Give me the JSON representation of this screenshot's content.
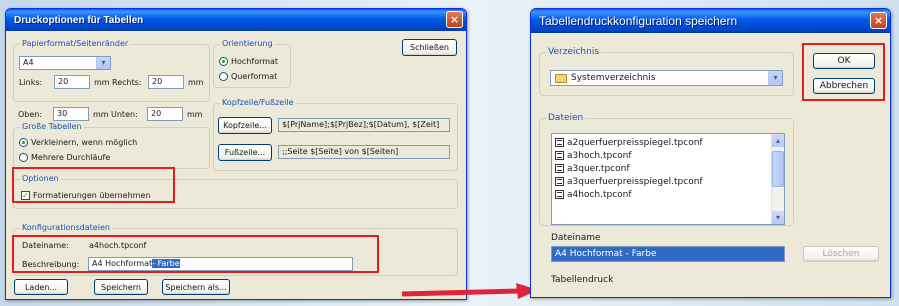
{
  "dialog1": {
    "title": "Druckoptionen für Tabellen",
    "close_glyph": "×",
    "paper_group": "Papierformat/Seitenränder",
    "paper_value": "A4",
    "left_label": "Links:",
    "left_value": "20",
    "left_unit": "mm",
    "right_label": "Rechts:",
    "right_value": "20",
    "right_unit": "mm",
    "top_label": "Oben:",
    "top_value": "30",
    "top_unit": "mm",
    "bottom_label": "Unten:",
    "bottom_value": "20",
    "bottom_unit": "mm",
    "orientation_group": "Orientierung",
    "portrait": "Hochformat",
    "landscape": "Querformat",
    "close_button": "Schließen",
    "large_tables_group": "Große Tabellen",
    "shrink_option": "Verkleinern, wenn möglich",
    "multi_option": "Mehrere Durchläufe",
    "header_footer_group": "Kopfzeile/Fußzeile",
    "header_button": "Kopfzeile...",
    "header_value": "$[PrjName];$[PrjBez];$[Datum], $[Zeit]",
    "footer_button": "Fußzeile...",
    "footer_value": ";;Seite $[Seite] von $[Seiten]",
    "options_group": "Optionen",
    "apply_formatting": "Formatierungen übernehmen",
    "config_group": "Konfigurationsdateien",
    "filename_label": "Dateiname:",
    "filename_value": "a4hoch.tpconf",
    "description_label": "Beschreibung:",
    "description_plain": "A4 Hochformat",
    "description_selected": "- Farbe",
    "load_button": "Laden...",
    "save_button": "Speichern",
    "save_as_button": "Speichern als..."
  },
  "dialog2": {
    "title": "Tabellendruckkonfiguration speichern",
    "close_glyph": "×",
    "directory_group": "Verzeichnis",
    "directory_value": "Systemverzeichnis",
    "ok_button": "OK",
    "cancel_button": "Abbrechen",
    "files_group": "Dateien",
    "files": [
      "a2querfuerpreisspiegel.tpconf",
      "a3hoch.tpconf",
      "a3quer.tpconf",
      "a3querfuerpreisspiegel.tpconf",
      "a4hoch.tpconf"
    ],
    "filename_label": "Dateiname",
    "filename_value": "A4 Hochformat - Farbe",
    "delete_button": "Löschen",
    "print_label": "Tabellendruck"
  },
  "colors": {
    "highlight": "#e02020",
    "arrow": "#e0243a",
    "titlebar": "#0058e6"
  }
}
